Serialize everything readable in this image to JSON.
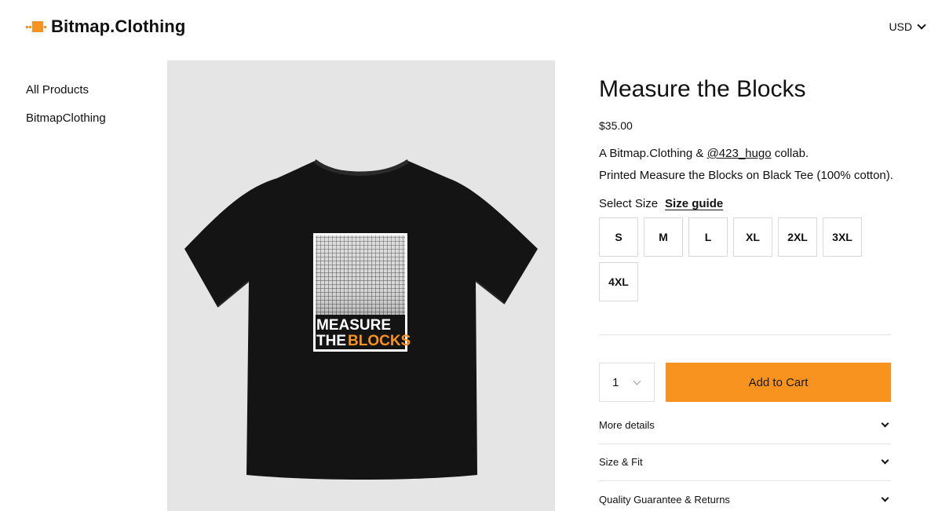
{
  "header": {
    "brand": "Bitmap.Clothing",
    "currency": "USD"
  },
  "sidebar": {
    "items": [
      {
        "label": "All Products"
      },
      {
        "label": "BitmapClothing"
      }
    ]
  },
  "product": {
    "title": "Measure the Blocks",
    "price": "$35.00",
    "desc_prefix": "A Bitmap.Clothing & ",
    "desc_link": "@423_hugo",
    "desc_suffix": " collab.",
    "desc_line2": "Printed Measure the Blocks on Black Tee (100% cotton).",
    "image_alt": "Black t-shirt with Measure the Blocks print",
    "print_line1": "MEASURE",
    "print_line2a": "THE",
    "print_line2b": "BLOCKS"
  },
  "size": {
    "label": "Select Size",
    "guide_label": "Size guide",
    "options": [
      "S",
      "M",
      "L",
      "XL",
      "2XL",
      "3XL",
      "4XL"
    ]
  },
  "cart": {
    "quantity": "1",
    "add_label": "Add to Cart"
  },
  "accordions": [
    {
      "label": "More details"
    },
    {
      "label": "Size & Fit"
    },
    {
      "label": "Quality Guarantee & Returns"
    }
  ],
  "colors": {
    "accent": "#f7931e",
    "image_bg": "#e5e5e5",
    "shirt": "#111111"
  }
}
